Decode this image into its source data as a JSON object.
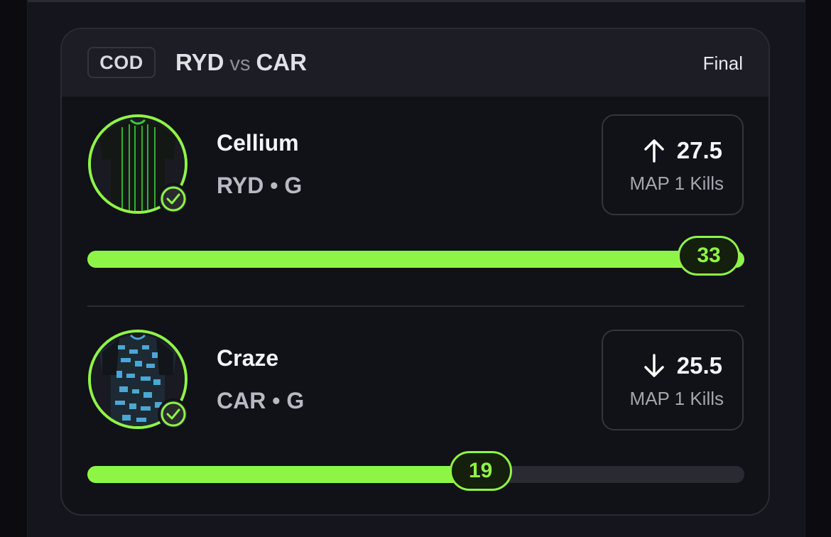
{
  "match": {
    "league": "COD",
    "team_home": "RYD",
    "vs": "vs",
    "team_away": "CAR",
    "status": "Final"
  },
  "players": [
    {
      "name": "Cellium",
      "team": "RYD",
      "position": "G",
      "meta": "RYD • G",
      "direction": "up",
      "direction_icon": "arrow-up-icon",
      "line": "27.5",
      "stat_label": "MAP 1 Kills",
      "result": "33",
      "progress": 1.0,
      "jersey": {
        "base": "#151a15",
        "accent": "#3acb3a"
      }
    },
    {
      "name": "Craze",
      "team": "CAR",
      "position": "G",
      "meta": "CAR • G",
      "direction": "down",
      "direction_icon": "arrow-down-icon",
      "line": "25.5",
      "stat_label": "MAP 1 Kills",
      "result": "19",
      "progress": 0.605,
      "jersey": {
        "base": "#1e2a33",
        "accent": "#4aa7d6"
      }
    }
  ],
  "colors": {
    "accent": "#8ef546",
    "card_bg": "#111118",
    "header_bg": "#1d1d25",
    "track": "#2a2a32"
  }
}
